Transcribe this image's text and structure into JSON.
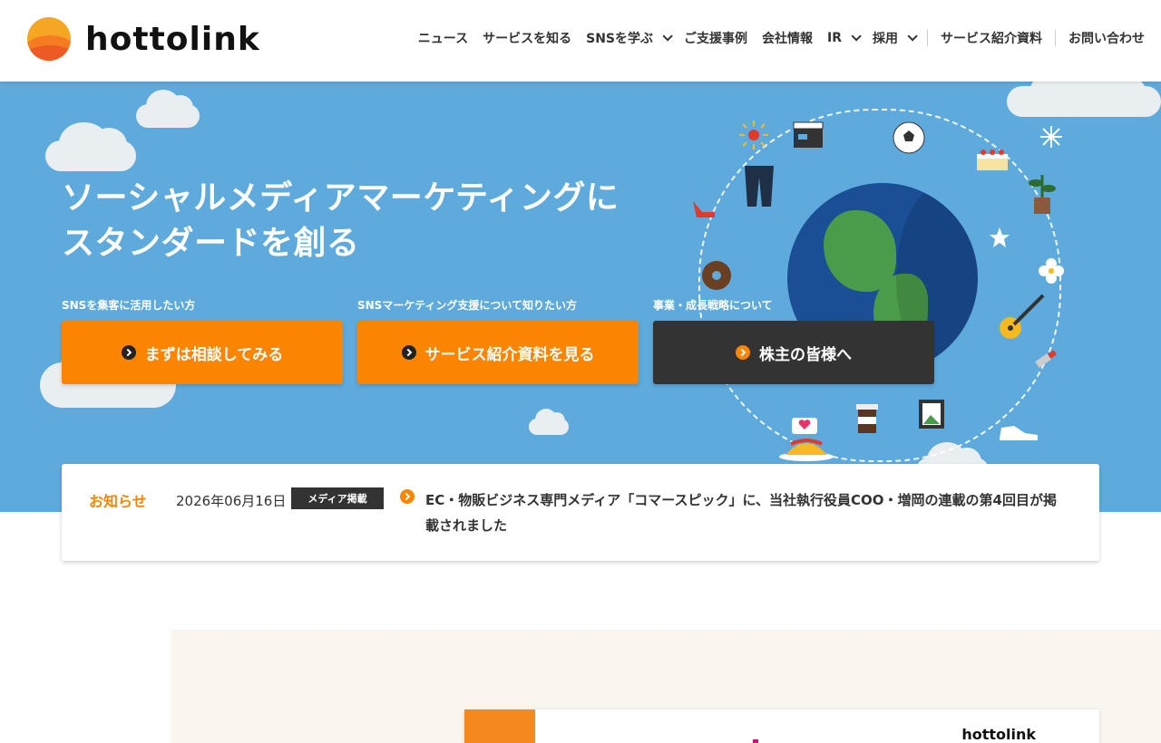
{
  "header": {
    "logo_text": "hottolink",
    "nav": [
      {
        "label": "ニュース",
        "dropdown": false
      },
      {
        "label": "サービスを知る",
        "dropdown": false
      },
      {
        "label": "SNSを学ぶ",
        "dropdown": true
      },
      {
        "label": "ご支援事例",
        "dropdown": false
      },
      {
        "label": "会社情報",
        "dropdown": false
      },
      {
        "label": "IR",
        "dropdown": true
      },
      {
        "label": "採用",
        "dropdown": true
      },
      {
        "label": "サービス紹介資料",
        "dropdown": false
      },
      {
        "label": "お問い合わせ",
        "dropdown": false
      }
    ]
  },
  "hero": {
    "title_line1": "ソーシャルメディアマーケティングに",
    "title_line2": "スタンダードを創る",
    "ctas": [
      {
        "caption": "SNSを集客に活用したい方",
        "label": "まずは相談してみる",
        "style": "orange"
      },
      {
        "caption": "SNSマーケティング支援について知りたい方",
        "label": "サービス紹介資料を見る",
        "style": "orange"
      },
      {
        "caption": "事業・成長戦略について",
        "label": "株主の皆様へ",
        "style": "dark"
      }
    ]
  },
  "news": {
    "label": "お知らせ",
    "date": "2026年06月16日",
    "category": "メディア掲載",
    "text": "EC・物販ビジネス専門メディア「コマースピック」に、当社執行役員COO・増岡の連載の第4回目が掲載されました"
  },
  "card": {
    "logo_text": "hottolink"
  },
  "colors": {
    "accent": "#fb8500",
    "hero_bg": "#5eaadd",
    "dark_button": "#333333",
    "lower_bg": "#faf5ef"
  }
}
